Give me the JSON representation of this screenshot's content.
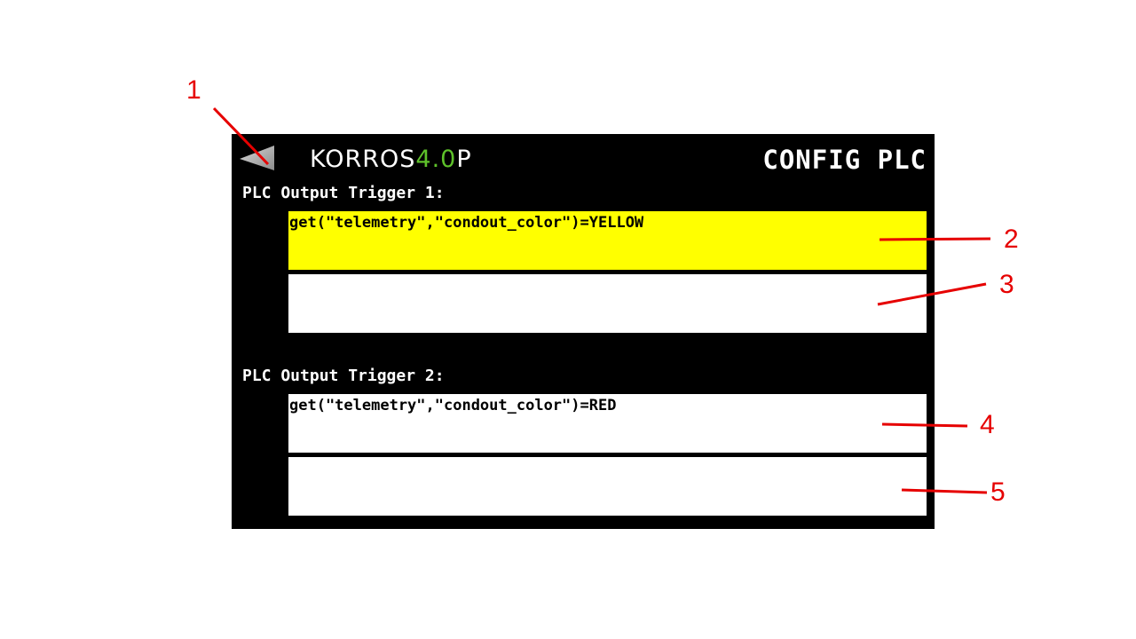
{
  "header": {
    "logo_prefix": "KORROS",
    "logo_accent": "4.0",
    "logo_suffix": "P",
    "title": "CONFIG PLC",
    "back_icon": "triangle-left-icon"
  },
  "triggers": [
    {
      "label": "PLC Output Trigger 1:",
      "condition": "get(\"telemetry\",\"condout_color\")=YELLOW",
      "action": ""
    },
    {
      "label": "PLC Output Trigger 2:",
      "condition": "get(\"telemetry\",\"condout_color\")=RED",
      "action": ""
    }
  ],
  "annotations": [
    "1",
    "2",
    "3",
    "4",
    "5"
  ],
  "colors": {
    "annotation": "#e60000",
    "active_field": "#ffff00",
    "logo_accent": "#5ec12a",
    "screen_bg": "#000000"
  }
}
